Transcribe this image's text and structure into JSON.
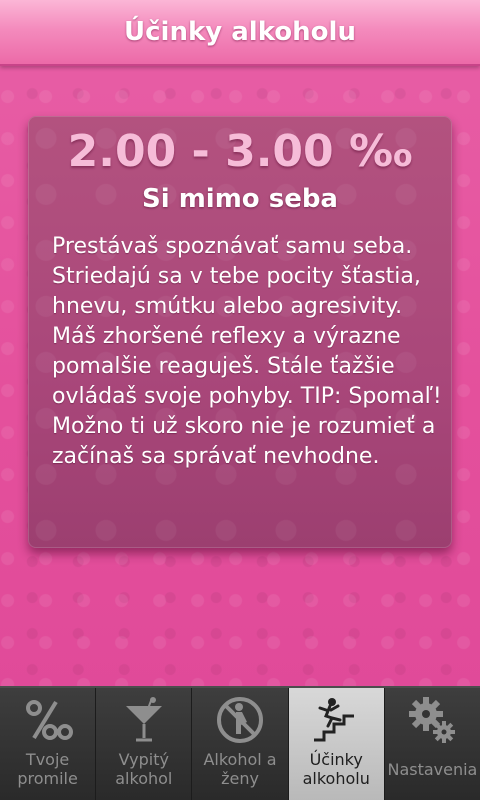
{
  "header": {
    "title": "Účinky alkoholu"
  },
  "card": {
    "range": "2.00 - 3.00 ‰",
    "heading": "Si mimo seba",
    "description": "Prestávaš spoznávať samu seba. Striedajú sa v tebe pocity šťastia, hnevu, smútku alebo agresivity. Máš zhoršené reflexy a výrazne pomalšie reaguješ. Stále ťažšie ovládaš svoje pohyby. TIP: Spomaľ! Možno ti už skoro nie je rozumieť a začínaš sa správať nevhodne."
  },
  "tabs": [
    {
      "label": "Tvoje\npromile",
      "icon": "permille-icon",
      "active": false
    },
    {
      "label": "Vypitý\nalkohol",
      "icon": "cocktail-glass-icon",
      "active": false
    },
    {
      "label": "Alkohol a\nženy",
      "icon": "pregnant-woman-icon",
      "active": false
    },
    {
      "label": "Účinky\nalkoholu",
      "icon": "falling-stairs-icon",
      "active": true
    },
    {
      "label": "Nastavenia",
      "icon": "gears-icon",
      "active": false
    }
  ],
  "colors": {
    "background": "#e4509c",
    "title_bar": "#f48bbd",
    "card": "#a9477a",
    "range_text": "#f6bcd8",
    "tab_bar": "#333333",
    "active_tab": "#c8c8c8"
  }
}
